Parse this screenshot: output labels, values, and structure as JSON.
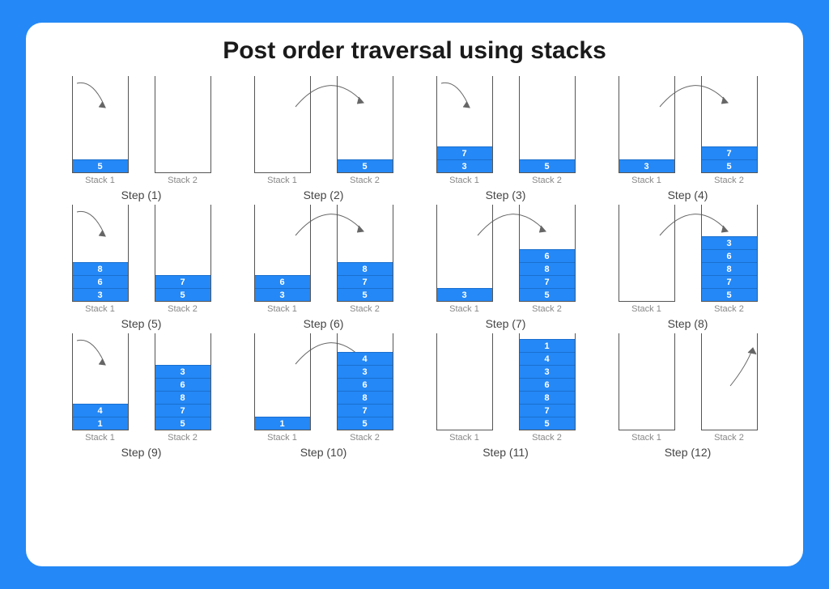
{
  "title": "Post order traversal using stacks",
  "stack_labels": [
    "Stack 1",
    "Stack 2"
  ],
  "steps": [
    {
      "label": "Step (1)",
      "arrow": "into1",
      "s1": [
        "5"
      ],
      "s2": []
    },
    {
      "label": "Step (2)",
      "arrow": "across",
      "s1": [],
      "s2": [
        "5"
      ]
    },
    {
      "label": "Step (3)",
      "arrow": "into1",
      "s1": [
        "3",
        "7"
      ],
      "s2": [
        "5"
      ]
    },
    {
      "label": "Step (4)",
      "arrow": "across",
      "s1": [
        "3"
      ],
      "s2": [
        "5",
        "7"
      ]
    },
    {
      "label": "Step (5)",
      "arrow": "into1",
      "s1": [
        "3",
        "6",
        "8"
      ],
      "s2": [
        "5",
        "7"
      ]
    },
    {
      "label": "Step (6)",
      "arrow": "across",
      "s1": [
        "3",
        "6"
      ],
      "s2": [
        "5",
        "7",
        "8"
      ]
    },
    {
      "label": "Step (7)",
      "arrow": "across",
      "s1": [
        "3"
      ],
      "s2": [
        "5",
        "7",
        "8",
        "6"
      ]
    },
    {
      "label": "Step (8)",
      "arrow": "across",
      "s1": [],
      "s2": [
        "5",
        "7",
        "8",
        "6",
        "3"
      ]
    },
    {
      "label": "Step (9)",
      "arrow": "into1",
      "s1": [
        "1",
        "4"
      ],
      "s2": [
        "5",
        "7",
        "8",
        "6",
        "3"
      ]
    },
    {
      "label": "Step (10)",
      "arrow": "across",
      "s1": [
        "1"
      ],
      "s2": [
        "5",
        "7",
        "8",
        "6",
        "3",
        "4"
      ]
    },
    {
      "label": "Step (11)",
      "arrow": "none",
      "s1": [],
      "s2": [
        "5",
        "7",
        "8",
        "6",
        "3",
        "4",
        "1"
      ]
    },
    {
      "label": "Step (12)",
      "arrow": "out2",
      "s1": [],
      "s2": []
    }
  ]
}
